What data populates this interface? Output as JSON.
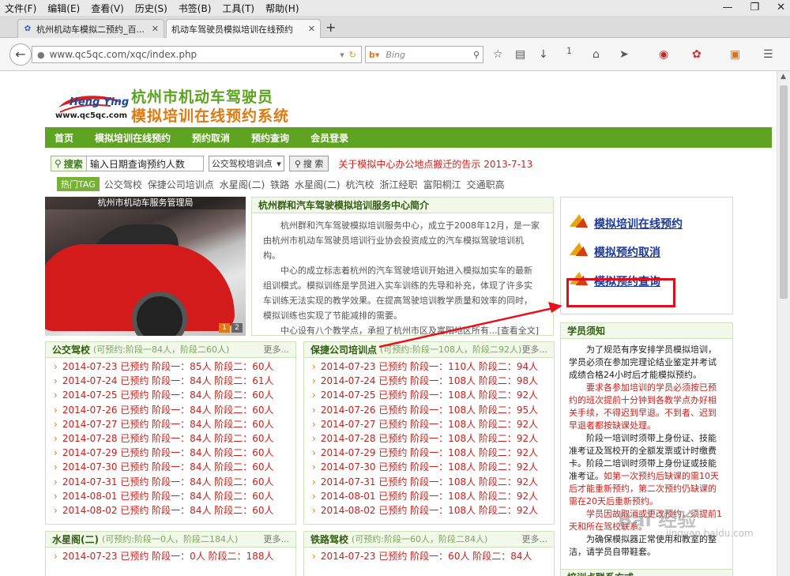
{
  "browser": {
    "menu": [
      "文件(F)",
      "编辑(E)",
      "查看(V)",
      "历史(S)",
      "书签(B)",
      "工具(T)",
      "帮助(H)"
    ],
    "tabs": [
      {
        "title": "杭州机动车模拟二预约_百..."
      },
      {
        "title": "机动车驾驶员模拟培训在线预约"
      }
    ],
    "url": "www.qc5qc.com/xqc/index.php",
    "search_placeholder": "Bing",
    "toolbar_count": "1"
  },
  "site": {
    "brand": "Heng Ying",
    "brand_url": "www.qc5qc.com",
    "title_line1": "杭州市机动车驾驶员",
    "title_line2": "模拟培训在线预约系统",
    "nav": [
      "首页",
      "模拟培训在线预约",
      "预约取消",
      "预约查询",
      "会员登录"
    ],
    "search": {
      "button_label": "搜索",
      "input_value": "输入日期查询预约人数",
      "select_value": "公交驾校培训点",
      "go_label": "搜 索",
      "notice": "关于模拟中心办公地点搬迁的告示 2013-7-13"
    },
    "tags_label": "热门TAG",
    "tags": [
      "公交驾校",
      "保捷公司培训点",
      "水星阁(二)",
      "铁路",
      "水星阁(二)",
      "杭汽校",
      "浙江经职",
      "富阳桐江",
      "交通职高"
    ],
    "slide": {
      "caption": "杭州市机动车服务管理局",
      "pages": [
        "1",
        "2"
      ]
    },
    "intro": {
      "title": "杭州群和汽车驾驶模拟培训服务中心简介",
      "p1": "杭州群和汽车驾驶模拟培训服务中心，成立于2008年12月，是一家由杭州市机动车驾驶员培训行业协会投资成立的汽车模拟驾驶培训机构。",
      "p2": "中心的成立标志着杭州的汽车驾驶培训开始进入模拟加实车的最新组训模式。模拟训练是学员进入实车训练的先导和补充，体现了许多实车训练无法实现的教学效果。在提高驾驶培训教学质量和效率的同时，模拟训练也实现了节能减排的需要。",
      "p3": "中心设有八个教学点，承担了杭州市区及富阳地区所有...[查看全文]"
    },
    "quick_links": [
      "模拟培训在线预约",
      "模拟预约取消",
      "模拟预约查询"
    ],
    "notes": {
      "title": "学员须知",
      "p1": "为了规范有序安排学员模拟培训，学员必须在参加完理论结业鉴定并考试成绩合格24小时后才能模拟预约。",
      "p2_red": "要求各参加培训的学员必须按已预约的班次提前十分钟到各教学点办好相关手续，不得迟到早退。不到者、迟到早退者都按缺课处理。",
      "p3": "阶段一培训时须带上身份证、技能准考证及驾校开的全额发票或计时缴费卡。阶段二培训时须带上身份证或技能准考证。",
      "p3_red": "如第一次预约后缺课的需10天后才能重新预约，第二次预约仍缺课的需在20天后重新预约。",
      "p4_red": "学员因故取消或更改预约，须提前1天和所在驾校联系。",
      "p5": "为确保模拟器正常使用和教室的整洁，请学员自带鞋套。"
    },
    "watermark": "Bai 经验",
    "watermark_url": "jingyan.baidu.com",
    "lists": [
      {
        "title": "公交驾校",
        "sub": "(可预约:阶段一84人，阶段二60人)",
        "more": "更多...",
        "rows": [
          "2014-07-23 已预约 阶段一：85人 阶段二：60人",
          "2014-07-24 已预约 阶段一：84人 阶段二：61人",
          "2014-07-25 已预约 阶段一：84人 阶段二：60人",
          "2014-07-26 已预约 阶段一：84人 阶段二：60人",
          "2014-07-27 已预约 阶段一：84人 阶段二：60人",
          "2014-07-28 已预约 阶段一：84人 阶段二：60人",
          "2014-07-29 已预约 阶段一：84人 阶段二：60人",
          "2014-07-30 已预约 阶段一：84人 阶段二：60人",
          "2014-07-31 已预约 阶段一：84人 阶段二：60人",
          "2014-08-01 已预约 阶段一：84人 阶段二：60人",
          "2014-08-02 已预约 阶段一：84人 阶段二：60人"
        ]
      },
      {
        "title": "保捷公司培训点",
        "sub": "(可预约:阶段一108人，阶段二92人)",
        "more": "更多...",
        "rows": [
          "2014-07-23 已预约 阶段一：110人 阶段二：94人",
          "2014-07-24 已预约 阶段一：108人 阶段二：98人",
          "2014-07-25 已预约 阶段一：108人 阶段二：92人",
          "2014-07-26 已预约 阶段一：108人 阶段二：95人",
          "2014-07-27 已预约 阶段一：108人 阶段二：92人",
          "2014-07-28 已预约 阶段一：108人 阶段二：92人",
          "2014-07-29 已预约 阶段一：108人 阶段二：92人",
          "2014-07-30 已预约 阶段一：108人 阶段二：92人",
          "2014-07-31 已预约 阶段一：108人 阶段二：92人",
          "2014-08-01 已预约 阶段一：108人 阶段二：92人",
          "2014-08-02 已预约 阶段一：108人 阶段二：92人"
        ]
      },
      {
        "title": "水星阁(二)",
        "sub": "(可预约:阶段一0人，阶段二184人)",
        "more": "更多...",
        "rows": [
          "2014-07-23 已预约 阶段一：0人 阶段二：188人"
        ]
      },
      {
        "title": "铁路驾校",
        "sub": "(可预约:阶段一60人，阶段二84人)",
        "more": "更多...",
        "rows": [
          "2014-07-23 已预约 阶段一：60人 阶段二：84人"
        ]
      }
    ],
    "bottom_box_title": "培训点联系方式"
  }
}
